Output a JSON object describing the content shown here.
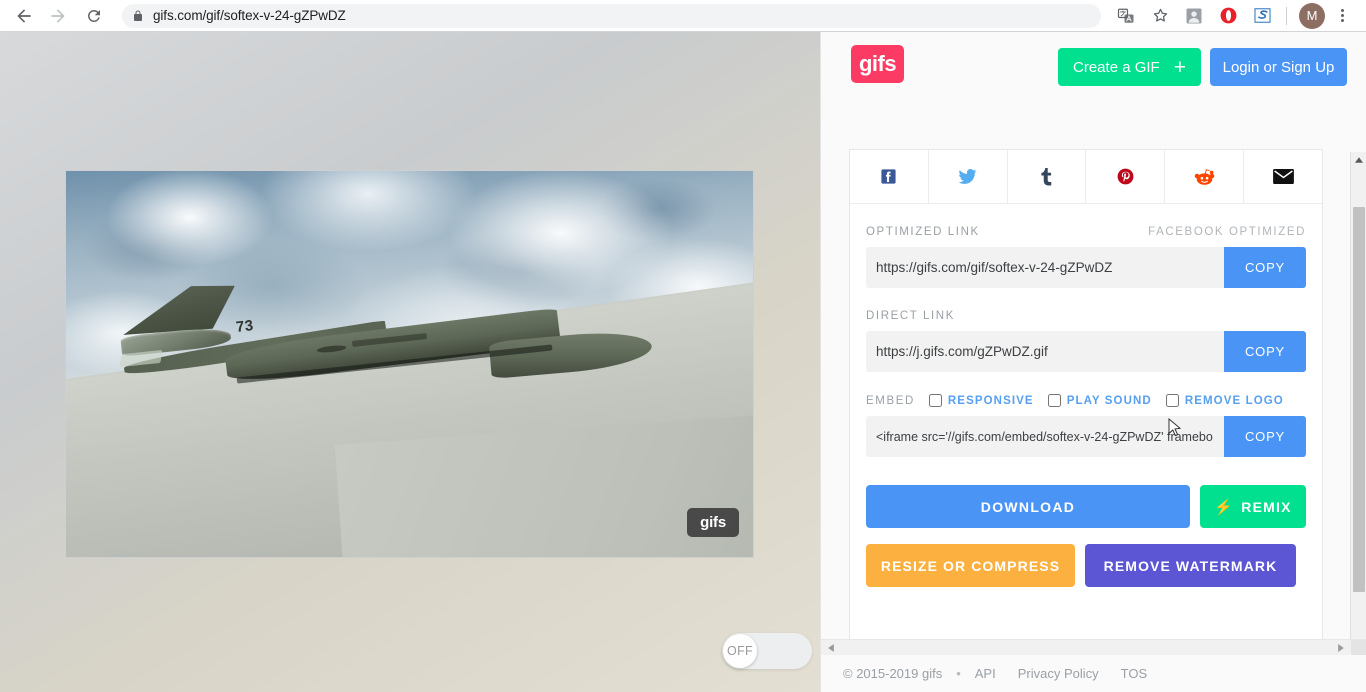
{
  "browser": {
    "back_icon": "back-arrow-icon",
    "forward_icon": "forward-arrow-icon",
    "reload_icon": "reload-icon",
    "lock_icon": "lock-icon",
    "url": "gifs.com/gif/softex-v-24-gZPwDZ",
    "extensions": [
      {
        "name": "translate-icon",
        "title": "Translate"
      },
      {
        "name": "bookmark-star-icon",
        "title": "Bookmark"
      },
      {
        "name": "avatar-extension-icon",
        "title": "Profile extension"
      },
      {
        "name": "opera-red-icon",
        "title": "Red circle extension"
      },
      {
        "name": "s-blue-icon",
        "title": "S extension"
      }
    ],
    "avatar_letter": "M",
    "menu_icon": "three-dot-menu-icon"
  },
  "viewer": {
    "watermark": "gifs",
    "aircraft_serial": "73",
    "sound_toggle": {
      "state_label": "OFF",
      "on": false
    }
  },
  "header": {
    "logo": "gifs",
    "create_gif_label": "Create a GIF",
    "create_gif_plus": "+",
    "login_label": "Login or Sign Up",
    "accent_green": "#00e08f",
    "accent_blue": "#4a94f5",
    "accent_pink": "#fb3b64"
  },
  "share": {
    "social": [
      {
        "name": "facebook-share-icon",
        "label": "Facebook",
        "color": "#3b5998"
      },
      {
        "name": "twitter-share-icon",
        "label": "Twitter",
        "color": "#55acee"
      },
      {
        "name": "tumblr-share-icon",
        "label": "Tumblr",
        "color": "#36465d"
      },
      {
        "name": "pinterest-share-icon",
        "label": "Pinterest",
        "color": "#bd081c"
      },
      {
        "name": "reddit-share-icon",
        "label": "Reddit",
        "color": "#ff4500"
      },
      {
        "name": "email-share-icon",
        "label": "Email",
        "color": "#111111"
      }
    ],
    "optimized": {
      "label": "OPTIMIZED LINK",
      "badge": "FACEBOOK OPTIMIZED",
      "value": "https://gifs.com/gif/softex-v-24-gZPwDZ",
      "copy_label": "COPY"
    },
    "direct": {
      "label": "DIRECT LINK",
      "value": "https://j.gifs.com/gZPwDZ.gif",
      "copy_label": "COPY"
    },
    "embed": {
      "label": "EMBED",
      "options": [
        {
          "label": "RESPONSIVE",
          "checked": false
        },
        {
          "label": "PLAY SOUND",
          "checked": false
        },
        {
          "label": "REMOVE LOGO",
          "checked": false
        }
      ],
      "value": "<iframe src='//gifs.com/embed/softex-v-24-gZPwDZ' framebo",
      "copy_label": "COPY"
    }
  },
  "actions": {
    "download_label": "DOWNLOAD",
    "remix_label": "REMIX",
    "remix_icon": "lightning-bolt-icon",
    "resize_label": "RESIZE OR COMPRESS",
    "watermark_label": "REMOVE WATERMARK",
    "download_color": "#4a94f5",
    "remix_color": "#00e08f",
    "resize_color": "#fbb03f",
    "watermark_color": "#5c55d4"
  },
  "footer": {
    "copyright": "© 2015-2019 gifs",
    "separator": "•",
    "links": [
      "API",
      "Privacy Policy",
      "TOS"
    ]
  }
}
